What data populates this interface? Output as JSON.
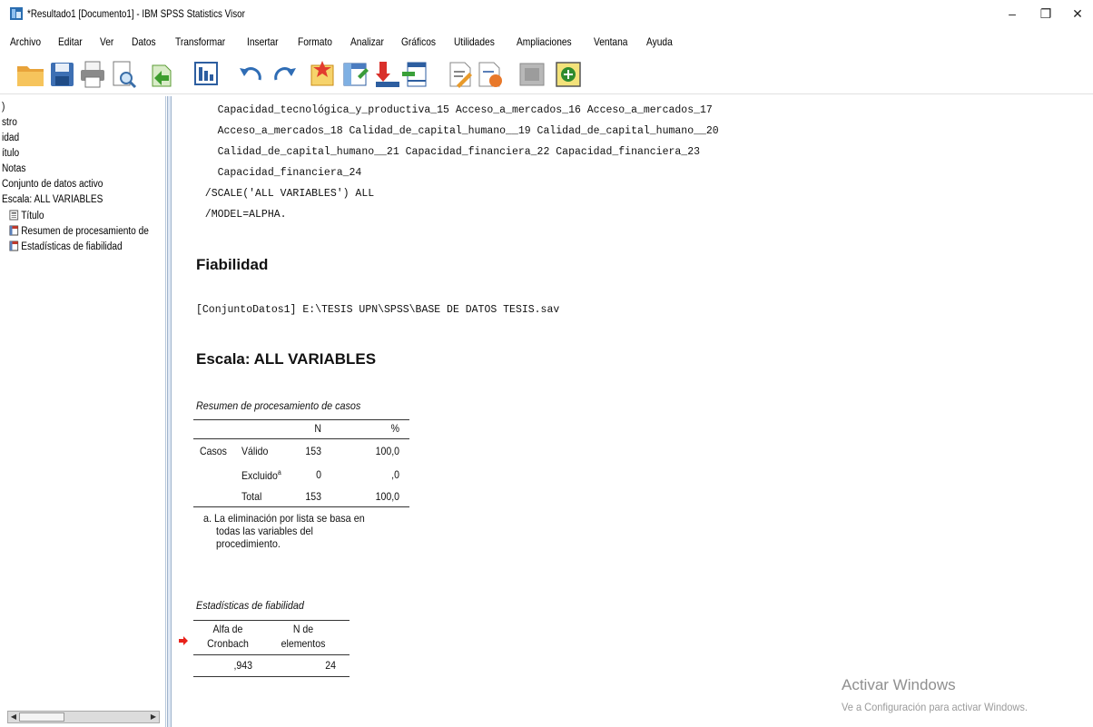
{
  "window": {
    "title": "*Resultado1 [Documento1] - IBM SPSS Statistics Visor",
    "minimize": "–",
    "maximize": "❐",
    "close": "✕"
  },
  "menu": [
    "Archivo",
    "Editar",
    "Ver",
    "Datos",
    "Transformar",
    "Insertar",
    "Formato",
    "Analizar",
    "Gráficos",
    "Utilidades",
    "Ampliaciones",
    "Ventana",
    "Ayuda"
  ],
  "outline": {
    "items": [
      ")",
      "stro",
      "idad",
      "ítulo",
      "Notas",
      "Conjunto de datos activo",
      "Escala: ALL VARIABLES",
      "Título",
      "Resumen de procesamiento de",
      "Estadísticas de fiabilidad"
    ]
  },
  "syntax": {
    "lines": [
      "    Capacidad_tecnológica_y_productiva_15 Acceso_a_mercados_16 Acceso_a_mercados_17",
      "    Acceso_a_mercados_18 Calidad_de_capital_humano__19 Calidad_de_capital_humano__20",
      "    Calidad_de_capital_humano__21 Capacidad_financiera_22 Capacidad_financiera_23",
      "    Capacidad_financiera_24",
      "  /SCALE('ALL VARIABLES') ALL",
      "  /MODEL=ALPHA."
    ]
  },
  "output": {
    "heading_fiabilidad": "Fiabilidad",
    "dataset_line": "[ConjuntoDatos1] E:\\TESIS UPN\\SPSS\\BASE DE DATOS TESIS.sav",
    "heading_escala": "Escala: ALL VARIABLES",
    "case_summary": {
      "caption": "Resumen de procesamiento de casos",
      "col_n": "N",
      "col_pct": "%",
      "group_label": "Casos",
      "rows": [
        {
          "label": "Válido",
          "sup": "",
          "n": "153",
          "pct": "100,0"
        },
        {
          "label": "Excluido",
          "sup": "a",
          "n": "0",
          "pct": ",0"
        },
        {
          "label": "Total",
          "sup": "",
          "n": "153",
          "pct": "100,0"
        }
      ],
      "footnote": [
        "a. La eliminación por lista se basa en",
        "todas las variables del",
        "procedimiento."
      ]
    },
    "reliability": {
      "caption": "Estadísticas de fiabilidad",
      "col_alpha": [
        "Alfa de",
        "Cronbach"
      ],
      "col_items": [
        "N de",
        "elementos"
      ],
      "alpha": ",943",
      "n_items": "24"
    }
  },
  "watermark": {
    "line1": "Activar Windows",
    "line2": "Ve a Configuración para activar Windows."
  }
}
